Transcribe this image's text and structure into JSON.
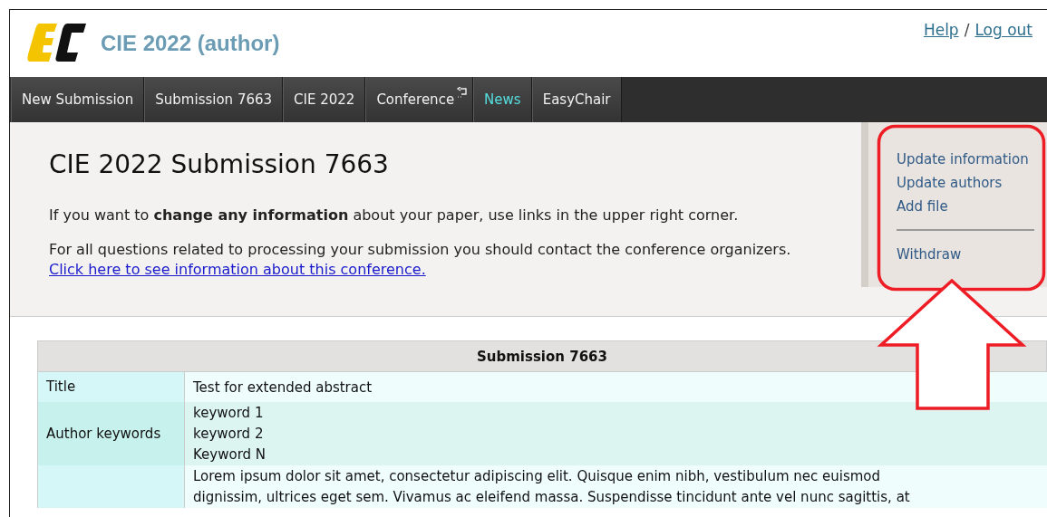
{
  "header": {
    "title": "CIE 2022 (author)",
    "links": [
      "Help",
      "Log out"
    ],
    "separator": "/"
  },
  "nav": [
    {
      "label": "New Submission",
      "kind": "plain"
    },
    {
      "label": "Submission 7663",
      "kind": "plain"
    },
    {
      "label": "CIE 2022",
      "kind": "plain"
    },
    {
      "label": "Conference",
      "kind": "menu"
    },
    {
      "label": "News",
      "kind": "news"
    },
    {
      "label": "EasyChair",
      "kind": "plain"
    }
  ],
  "summary": {
    "heading": "CIE 2022 Submission 7663",
    "intro": "If you want to **change any information** about your paper, use links in the upper right corner.",
    "contact": "For all questions related to processing your submission you should contact the conference organizers.",
    "link": "Click here to see information about this conference."
  },
  "actions": [
    {
      "label": "Update information",
      "divider_above": false
    },
    {
      "label": "Update authors",
      "divider_above": false
    },
    {
      "label": "Add file",
      "divider_above": false
    },
    {
      "label": "Withdraw",
      "divider_above": true
    }
  ],
  "table": {
    "title": "Submission 7663",
    "rows": [
      {
        "label": "Title",
        "lines": [
          "Test for extended abstract"
        ]
      },
      {
        "label": "Author keywords",
        "lines": [
          "keyword 1",
          "keyword 2",
          "Keyword N"
        ]
      },
      {
        "lines": [
          "Lorem ipsum dolor sit amet, consectetur adipiscing elit. Quisque enim nibh, vestibulum nec euismod",
          "dignissim, ultrices eget sem. Vivamus ac eleifend massa. Suspendisse tincidunt ante vel nunc sagittis, at"
        ]
      }
    ]
  }
}
